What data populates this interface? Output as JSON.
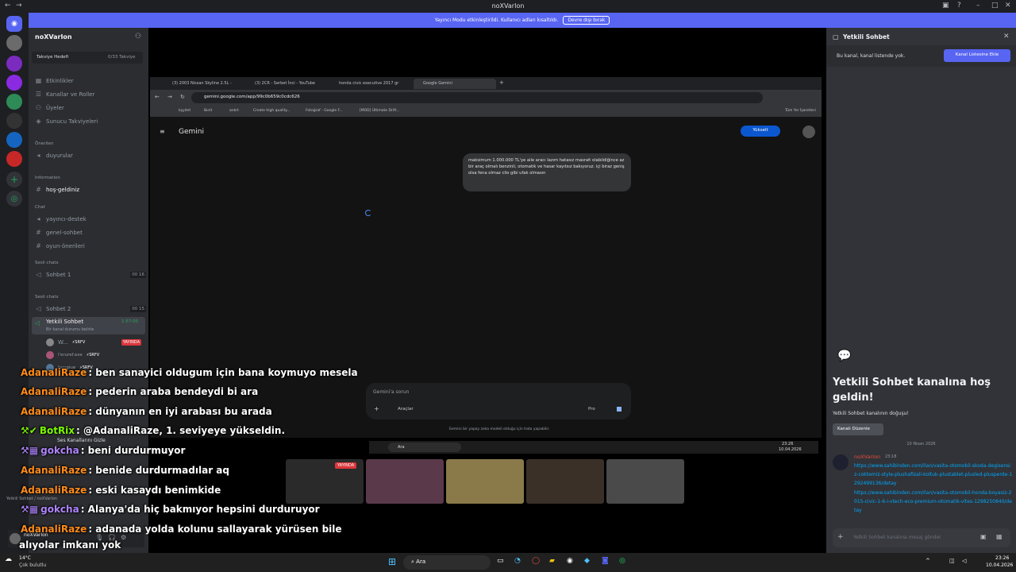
{
  "window": {
    "title": "noXVarIon"
  },
  "banner": {
    "text": "Yayıncı Modu etkinleştirildi. Kullanıcı adları kısaltıldı.",
    "button": "Devre dışı bırak"
  },
  "guild": {
    "name": "noXVarIon",
    "boost_label": "Takviye Hedefi",
    "boost_value": "0/33 Takviye"
  },
  "menu": [
    "Etkinlikler",
    "Kanallar ve Roller",
    "Üyeler",
    "Sunucu Takviyeleri"
  ],
  "categories": {
    "suggested": "Önerilen",
    "information": "Information",
    "chat": "Chat",
    "voice1": "Sesli chats",
    "voice2": "Sesli chats"
  },
  "channels": {
    "duyurular": "duyurular",
    "hosgeldiniz": "hoş-geldiniz",
    "destek": "yayıncı-destek",
    "genel": "genel-sohbet",
    "oneriler": "oyun-önerileri",
    "sohbet1": "Sohbet 1",
    "sohbet1_count": "00 16",
    "sohbet2": "Sohbet 2",
    "sohbet2_count": "00 15",
    "yetkili": "Yetkili Sohbet",
    "yetkili_time": "1:57:05",
    "yetkili_sub": "Bir kanal durumu belirle"
  },
  "voice_users": [
    {
      "name": "W...",
      "tag": "⚡SRFV",
      "badge": "YAYINDA"
    },
    {
      "name": "l'eruref.exe",
      "tag": "⚡SRFV",
      "badge": ""
    },
    {
      "name": "bengiue",
      "tag": "⚡SRFV",
      "badge": ""
    }
  ],
  "user": {
    "name": "noXVarIon",
    "sub": "Yetkili Sohbet / noXVarIon",
    "status": "Ses Kanallarını Gizle"
  },
  "browser": {
    "tabs": [
      "(3) 2003 Nissan Skyline 2.5L - ",
      "(3) 2CR - Serbet İnci - YouTube",
      "honda civic executive 2017 gr",
      "Google Gemini"
    ],
    "url": "gemini.google.com/app/99c0b659c0cdc626",
    "bookmarks": [
      "kşydnt",
      "Bınit",
      "ankrt",
      "Create high quality...",
      "Fotoğraf - Google F...",
      "[MOD] Ultimate Drift..."
    ],
    "bookmark_right": "Tüm Yer İşaretleri"
  },
  "gemini": {
    "title": "Gemini",
    "upgrade": "Yükselt",
    "prompt": "maksimum 1.000.000 TL'ye aile aracı lazım hatasız masrafı olabildiğince az bir araç olmalı benzinli, otomatik ve hasar kayıtsız bakıyoruz. içi biraz geniş olsa fena olmaz clio gibi ufak olmasın",
    "input_placeholder": "Gemini'a sorun",
    "tools": "Araçlar",
    "model": "Pro",
    "disclaimer": "Gemini bir yapay zeka modeli olduğu için hata yapabilir."
  },
  "inner_taskbar": {
    "search": "Ara",
    "time": "23:26",
    "date": "10.04.2026"
  },
  "chat_messages": [
    {
      "user": "AdanaliRaze",
      "text": ": ben sanayici oldugum için bana koymuyo mesela",
      "color": "#ff8c1a",
      "badges": ""
    },
    {
      "user": "AdanaliRaze",
      "text": ": pederin araba bendeydi bi ara",
      "color": "#ff8c1a",
      "badges": ""
    },
    {
      "user": "AdanaliRaze",
      "text": ": dünyanın en iyi arabası bu arada",
      "color": "#ff8c1a",
      "badges": ""
    },
    {
      "user": "BotRix",
      "text": ": @AdanaliRaze, 1. seviyeye yükseldin.",
      "color": "#7cfc00",
      "badges": "⚒✔",
      "mention": true
    },
    {
      "user": "gokcha",
      "text": ": beni durdurmuyor",
      "color": "#b084ff",
      "badges": "⚒▦"
    },
    {
      "user": "AdanaliRaze",
      "text": ": benide durdurmadılar aq",
      "color": "#ff8c1a",
      "badges": ""
    },
    {
      "user": "AdanaliRaze",
      "text": ": eski kasaydı benimkide",
      "color": "#ff8c1a",
      "badges": ""
    },
    {
      "user": "gokcha",
      "text": ": Alanya'da hiç bakmıyor hepsini durduruyor",
      "color": "#b084ff",
      "badges": "⚒▦"
    },
    {
      "user": "AdanaliRaze",
      "text": ": adanada yolda kolunu sallayarak yürüsen bile",
      "color": "#ff8c1a",
      "badges": ""
    }
  ],
  "chat_tail": "alıyolar imkanı yok",
  "cams": {
    "live": "YAYINDA"
  },
  "rightpanel": {
    "header": "Yetkili Sohbet",
    "notice": "Bu kanal, kanal listende yok.",
    "add_button": "Kanal Listesine Ekle",
    "welcome": "Yetkili Sohbet kanalına hoş geldin!",
    "sub": "Yetkili Sohbet kanalının doğuşu!",
    "edit": "Kanalı Düzenle",
    "date": "10 Nisan 2026",
    "msg_user": "noXVarIon",
    "msg_time": "23:18",
    "link1": "https://www.sahibinden.com/ilan/vasita-otomobil-skoda-degisensiz-coktemiz-style-plushafizali-koltuk-plustablet-plusled-plusperde-1292499136/detay",
    "link2": "https://www.sahibinden.com/ilan/vasita-otomobil-honda-boyasiz-2015-civic-1-6-i-vtech-eco-premium-otomatik-vites-1298250840/detay",
    "input": "Yetkili Sohbet kanalına mesaj gönder"
  },
  "taskbar": {
    "weather_temp": "14°C",
    "weather_desc": "Çok bulutlu",
    "search": "Ara",
    "time": "23:26",
    "date": "10.04.2026"
  }
}
